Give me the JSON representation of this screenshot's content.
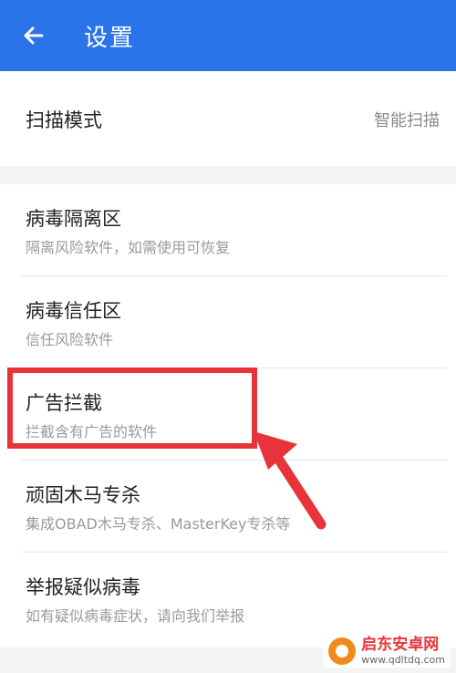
{
  "header": {
    "title": "设置"
  },
  "scan_mode": {
    "label": "扫描模式",
    "value": "智能扫描"
  },
  "items": [
    {
      "title": "病毒隔离区",
      "subtitle": "隔离风险软件，如需使用可恢复"
    },
    {
      "title": "病毒信任区",
      "subtitle": "信任风险软件"
    },
    {
      "title": "广告拦截",
      "subtitle": "拦截含有广告的软件"
    },
    {
      "title": "顽固木马专杀",
      "subtitle": "集成OBAD木马专杀、MasterKey专杀等"
    },
    {
      "title": "举报疑似病毒",
      "subtitle": "如有疑似病毒症状，请向我们举报"
    }
  ],
  "colors": {
    "app_bar": "#2a73e8",
    "annotation": "#e8333a"
  },
  "watermark": {
    "name": "启东安卓网",
    "url": "www.qdltdq.com"
  }
}
